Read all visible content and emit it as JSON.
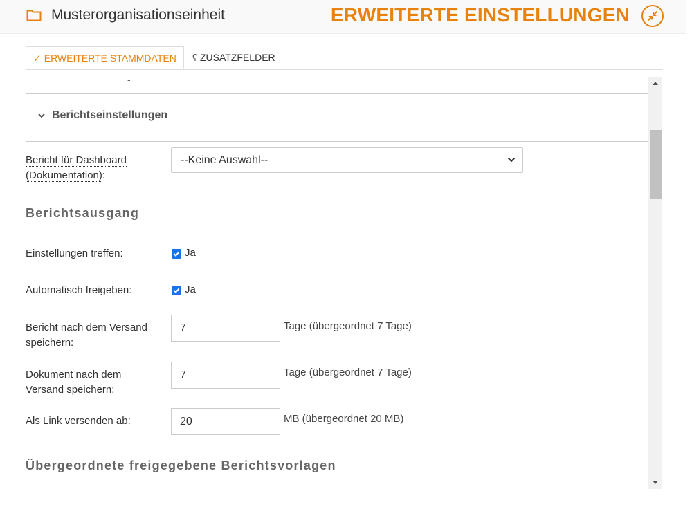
{
  "header": {
    "org_name": "Musterorganisationseinheit",
    "page_title": "ERWEITERTE EINSTELLUNGEN",
    "accent_color": "#e8820e"
  },
  "tabs": [
    {
      "label": "ERWEITERTE STAMMDATEN",
      "icon": "checkmark-icon",
      "active": true
    },
    {
      "label": "ZUSATZFELDER",
      "icon": "partial-hook-icon",
      "active": false
    }
  ],
  "top_remnant": "-",
  "section": {
    "title": "Berichtseinstellungen",
    "dashboard_report": {
      "label_line1": "Bericht für Dashboard",
      "label_line2": "(Dokumentation)",
      "label_suffix": ":",
      "value": "--Keine Auswahl--"
    },
    "output": {
      "heading": "Berichtsausgang",
      "settings": {
        "label": "Einstellungen treffen:",
        "checked": true,
        "option": "Ja"
      },
      "auto_release": {
        "label": "Automatisch freigeben:",
        "checked": true,
        "option": "Ja"
      },
      "report_keep": {
        "label_line1": "Bericht nach dem Versand",
        "label_line2": "speichern:",
        "value": "7",
        "hint": "Tage (übergeordnet 7 Tage)"
      },
      "doc_keep": {
        "label_line1": "Dokument nach dem",
        "label_line2": "Versand speichern:",
        "value": "7",
        "hint": "Tage (übergeordnet 7 Tage)"
      },
      "link_from": {
        "label": "Als Link versenden ab:",
        "value": "20",
        "hint": "MB (übergeordnet 20 MB)"
      }
    },
    "parent_templates_heading": "Übergeordnete freigegebene Berichtsvorlagen"
  }
}
